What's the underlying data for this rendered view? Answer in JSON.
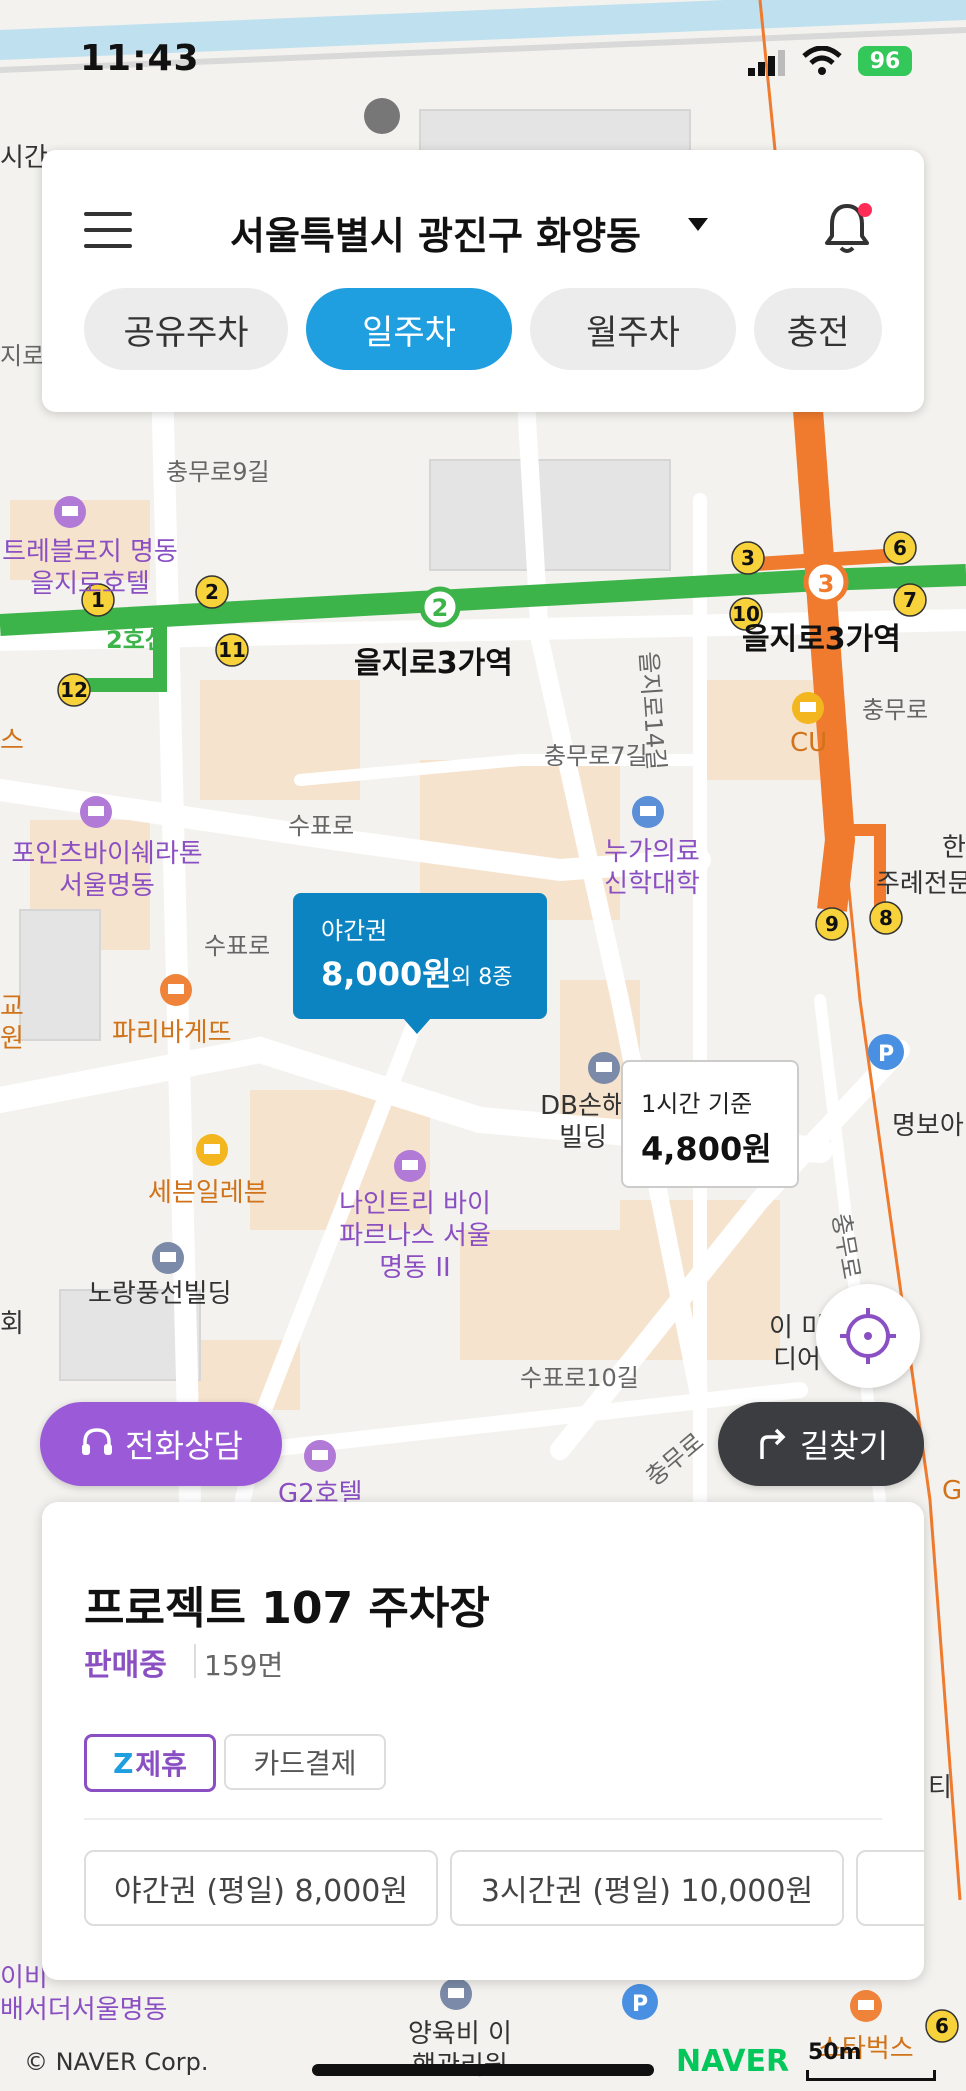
{
  "status_bar": {
    "time": "11:43",
    "battery": "96"
  },
  "header": {
    "location": "서울특별시 광진구 화양동",
    "tabs": [
      {
        "label": "공유주차",
        "active": false
      },
      {
        "label": "일주차",
        "active": true
      },
      {
        "label": "월주차",
        "active": false
      },
      {
        "label": "충전",
        "active": false
      }
    ]
  },
  "map": {
    "streets": [
      "충무로9길",
      "충무로7길",
      "수표로",
      "수표로",
      "을지로14길",
      "수표로10길",
      "충무로",
      "충무로",
      "충무로"
    ],
    "stations": [
      "을지로3가역",
      "을지로3가역"
    ],
    "line_labels": [
      "2호선"
    ],
    "exit_numbers": [
      "1",
      "2",
      "11",
      "12",
      "3",
      "6",
      "7",
      "10",
      "9",
      "8",
      "6"
    ],
    "pois": [
      {
        "name": "트레블로지 명동을지로호텔"
      },
      {
        "name": "포인츠바이쉐라톤 서울명동"
      },
      {
        "name": "나인트리 바이 파르나스 서울 명동 II"
      },
      {
        "name": "누가의료 신학대학"
      },
      {
        "name": "G2호텔"
      }
    ],
    "stores": [
      "CU",
      "세븐일레븐",
      "파리바게뜨",
      "스타벅스"
    ],
    "buildings": [
      "노랑풍선빌딩",
      "DB손해 빌딩",
      "명보아",
      "주례전문",
      "양육비 이행관리원",
      "이 미디어"
    ],
    "edge_fragments": [
      "시간",
      "지로",
      "스",
      "교",
      "원",
      "회",
      "한",
      "티",
      "이비",
      "배서더서울명동",
      "G"
    ]
  },
  "price_markers": [
    {
      "label": "야간권",
      "value": "8,000원",
      "more": "외 8종"
    },
    {
      "label": "1시간 기준",
      "value": "4,800원"
    }
  ],
  "buttons": {
    "call": "전화상담",
    "route": "길찾기"
  },
  "parking_lot": {
    "name": "프로젝트 107 주차장",
    "status": "판매중",
    "spaces": "159면",
    "tags": [
      "제휴",
      "카드결제"
    ],
    "tickets": [
      "야간권 (평일) 8,000원",
      "3시간권 (평일) 10,000원"
    ]
  },
  "footer": {
    "copyright": "© NAVER Corp.",
    "logo": "NAVER",
    "scale": "50m"
  },
  "colors": {
    "accent": "#1f9ee0",
    "purple": "#8a4fc2",
    "line2": "#3cb44a",
    "line3": "#f07b2e"
  },
  "icons": [
    "menu-icon",
    "bell-icon",
    "gps-icon",
    "headset-icon",
    "turn-right-icon",
    "hotel-icon",
    "store-icon",
    "parking-icon",
    "school-icon"
  ]
}
